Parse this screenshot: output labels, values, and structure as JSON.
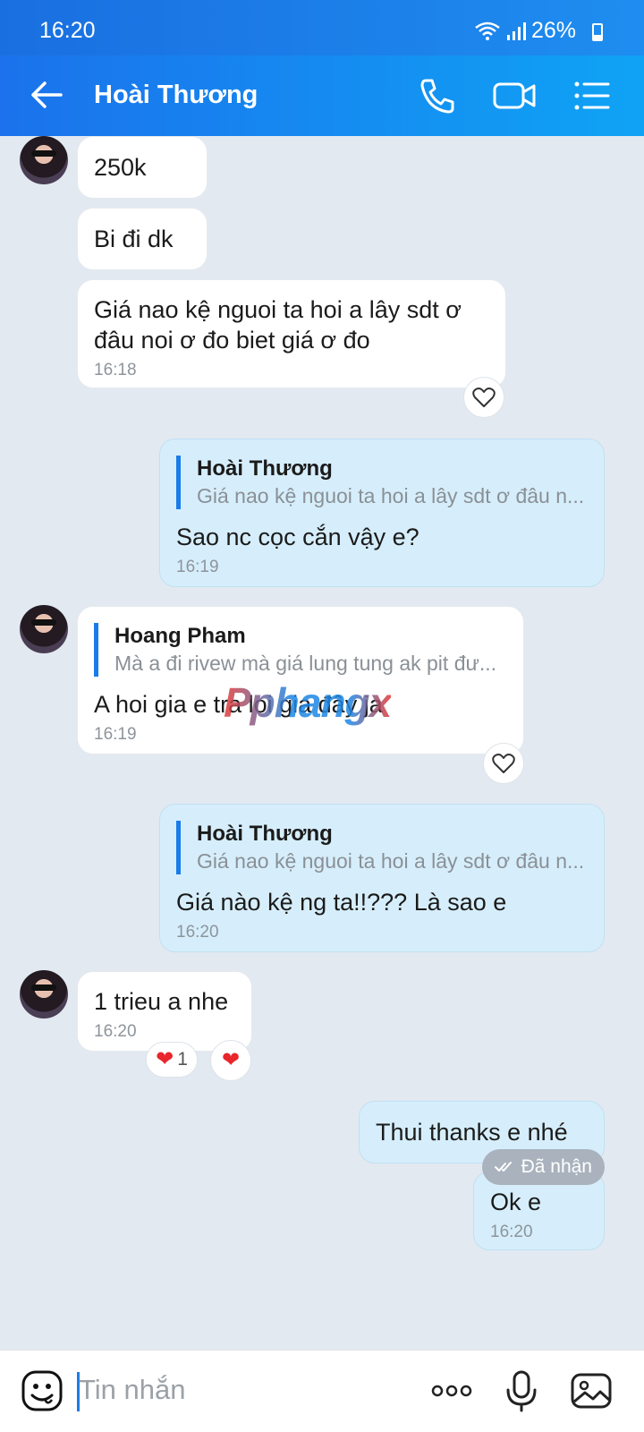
{
  "status_bar": {
    "time": "16:20",
    "battery": "26%"
  },
  "header": {
    "title": "Hoài Thương"
  },
  "messages": [
    {
      "text": "250k"
    },
    {
      "text": "Bi đi dk"
    },
    {
      "text": "Giá nao kệ nguoi ta hoi a lây sdt ơ đâu noi ơ đo biet giá ơ đo",
      "time": "16:18"
    },
    {
      "quote_name": "Hoài Thương",
      "quote_text": "Giá nao kệ nguoi ta hoi a lây sdt ơ đâu n...",
      "text": "Sao nc cọc cắn vậy e?",
      "time": "16:19"
    },
    {
      "quote_name": "Hoang Pham",
      "quote_text": "Mà a đi rivew mà giá lung tung ak pit đư...",
      "text": "A hoi gia e tra loi gia đây ja",
      "time": "16:19"
    },
    {
      "quote_name": "Hoài Thương",
      "quote_text": "Giá nao kệ nguoi ta hoi a lây sdt ơ đâu n...",
      "text": "Giá nào kệ ng ta!!??? Là sao e",
      "time": "16:20"
    },
    {
      "text": "1 trieu a nhe",
      "time": "16:20",
      "reaction_count": "1"
    },
    {
      "text": "Thui thanks e nhé"
    },
    {
      "text": "Ok e",
      "time": "16:20"
    }
  ],
  "delivery_status": "Đã nhận",
  "watermark": "Pphangx",
  "composer": {
    "placeholder": "Tin nhắn"
  },
  "colors": {
    "header": "#1b72ec",
    "outgoing_bubble": "#d6eefb",
    "incoming_bubble": "#ffffff",
    "background": "#e2e9f1",
    "accent": "#1a7ce8"
  }
}
